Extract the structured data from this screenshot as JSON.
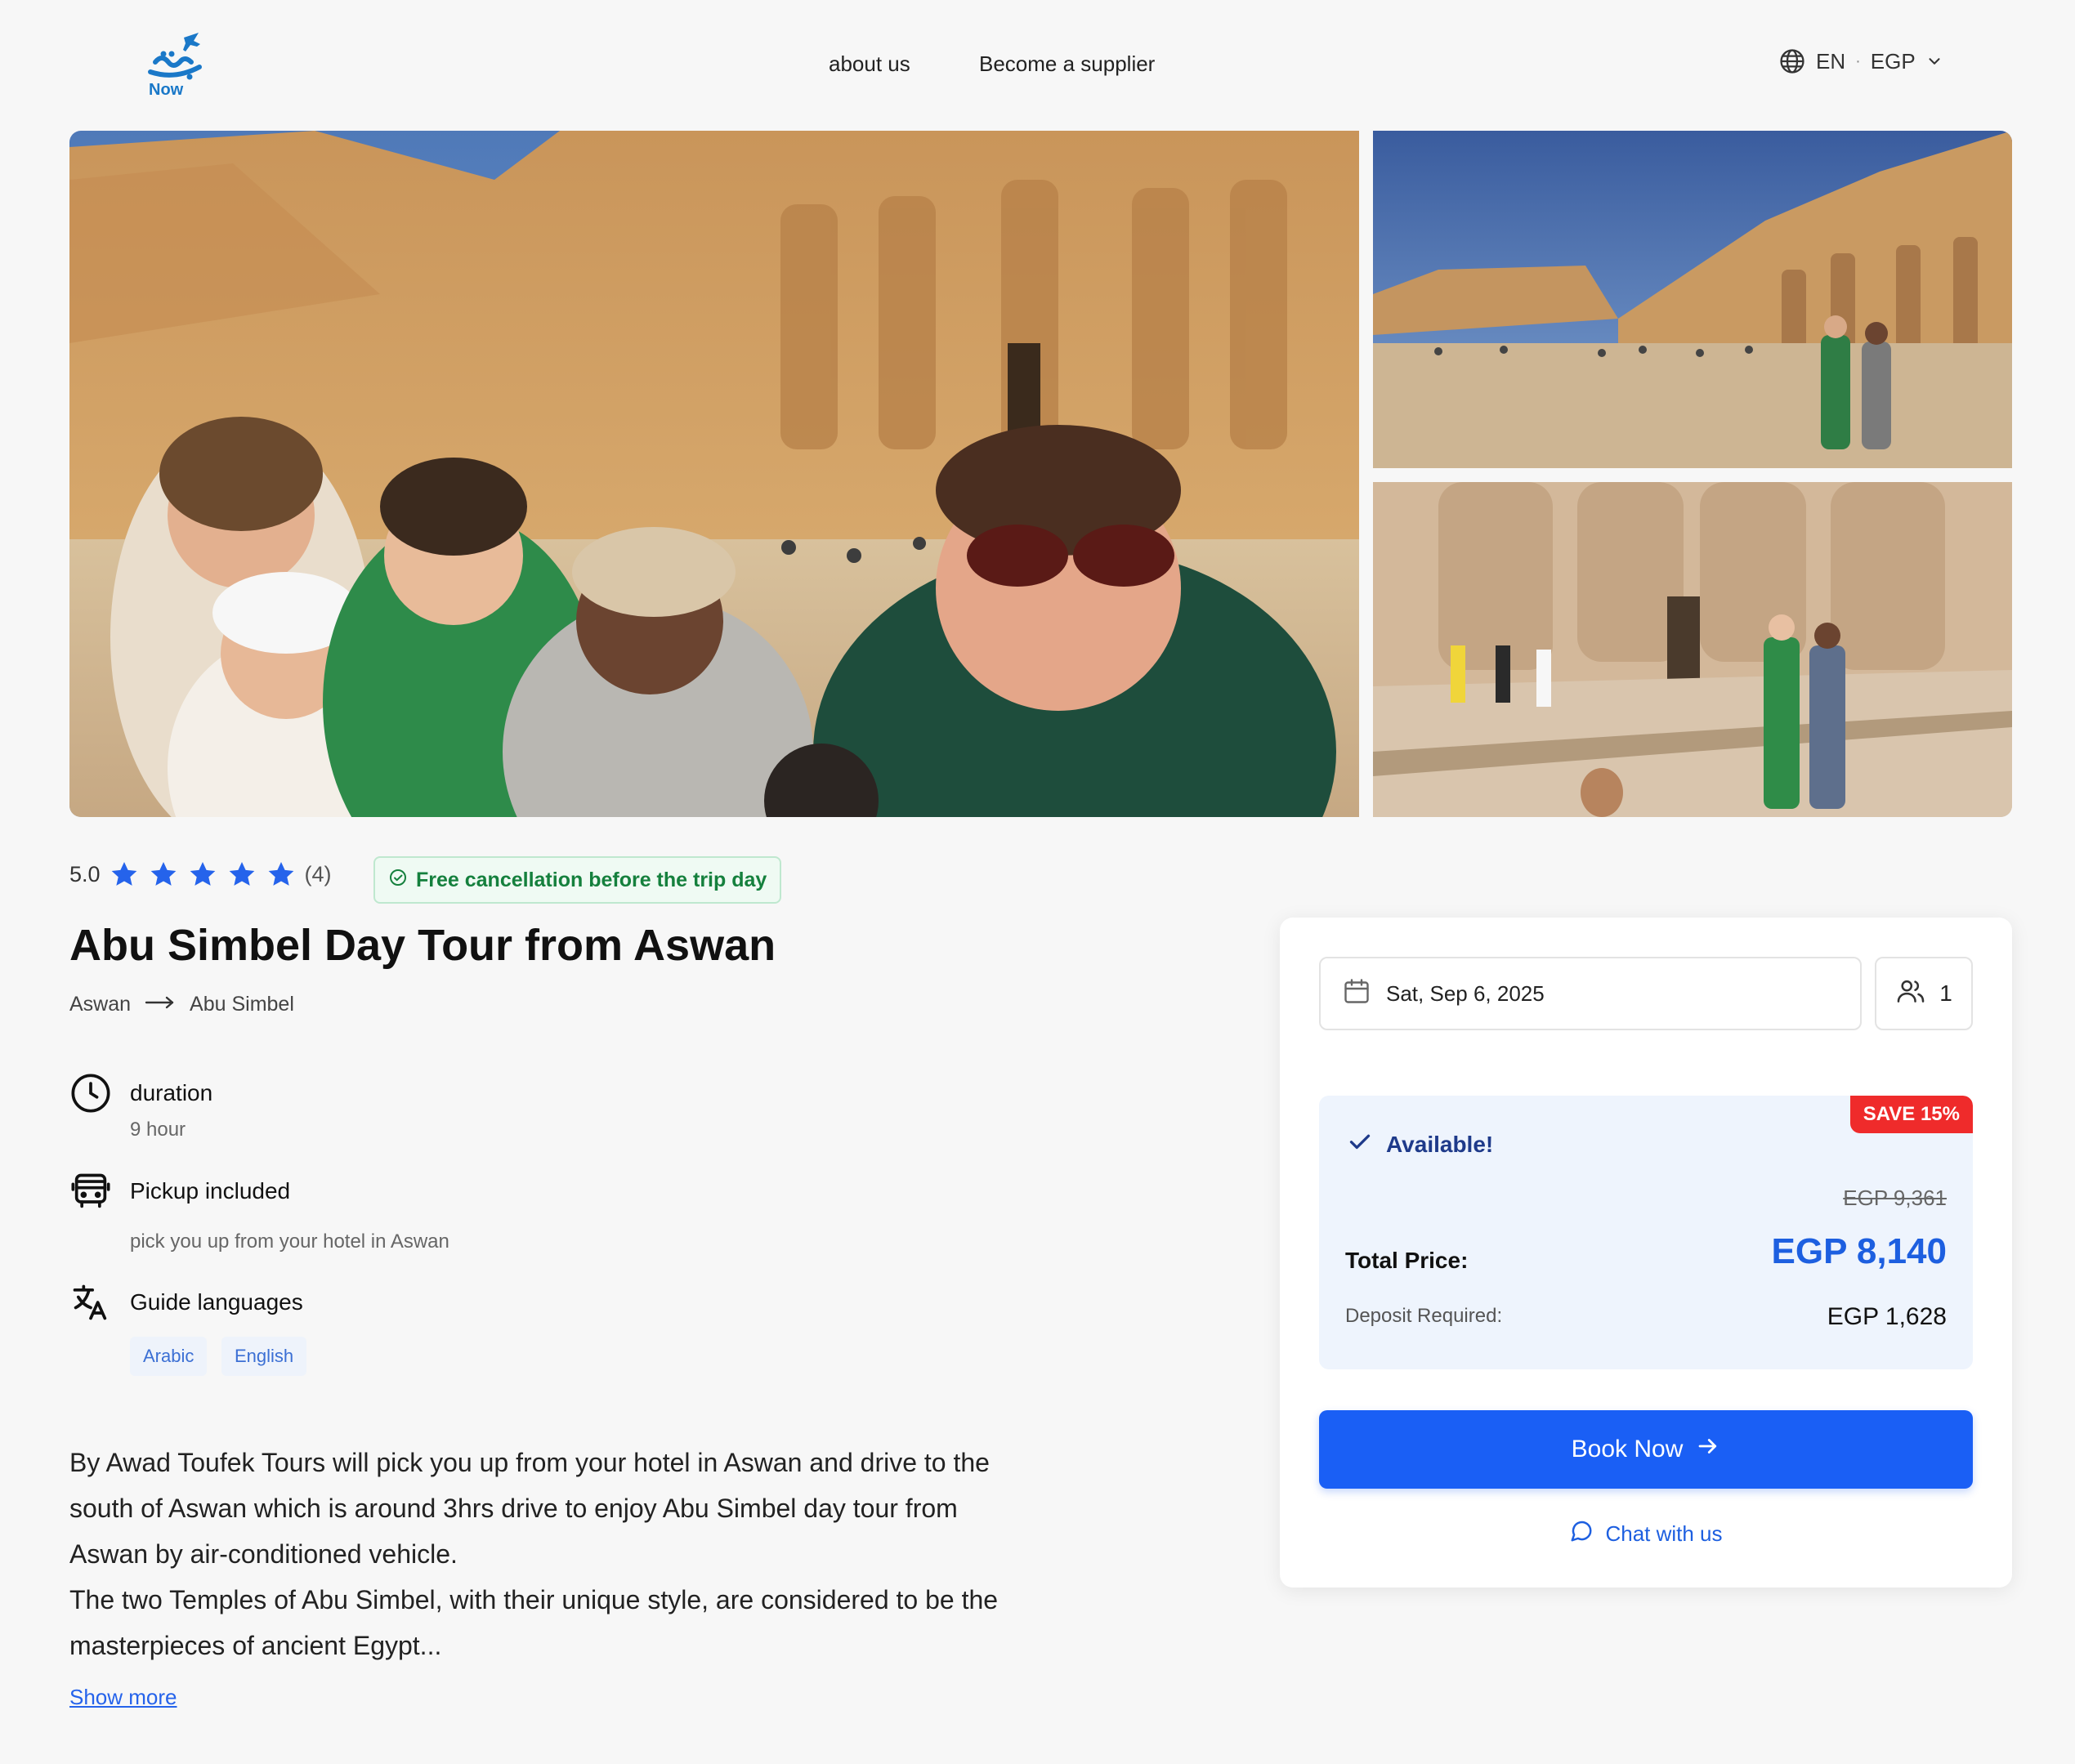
{
  "header": {
    "logo_text": "Now",
    "nav": [
      {
        "label": "about us"
      },
      {
        "label": "Become a supplier"
      }
    ],
    "locale": {
      "language": "EN",
      "separator": "·",
      "currency": "EGP"
    }
  },
  "gallery": {
    "images": [
      {
        "name": "family-selfie-abu-simbel"
      },
      {
        "name": "abu-simbel-temples-wide"
      },
      {
        "name": "ramses-statues-visitors"
      }
    ]
  },
  "rating": {
    "value": "5.0",
    "stars": 5,
    "count": "(4)"
  },
  "cancellation_badge": "Free cancellation before the trip day",
  "tour": {
    "title": "Abu Simbel Day Tour from Aswan",
    "route_from": "Aswan",
    "route_to": "Abu Simbel"
  },
  "features": {
    "duration_title": "duration",
    "duration_value": "9 hour",
    "pickup_title": "Pickup included",
    "pickup_value": "pick you up from your hotel in Aswan",
    "languages_title": "Guide languages",
    "languages": [
      "Arabic",
      "English"
    ]
  },
  "description": {
    "paragraph_1": "By Awad Toufek Tours will pick you up from your hotel in Aswan and drive to the south of Aswan which is around 3hrs drive to enjoy Abu Simbel day tour from Aswan by air-conditioned vehicle.",
    "paragraph_2": "The two Temples of Abu Simbel, with their unique style, are considered to be the masterpieces of ancient Egypt...",
    "show_more": "Show more"
  },
  "booking": {
    "date": "Sat, Sep 6, 2025",
    "guests": "1",
    "save_badge": "SAVE 15%",
    "available_label": "Available!",
    "old_price": "EGP 9,361",
    "total_label": "Total Price:",
    "total_price": "EGP 8,140",
    "deposit_label": "Deposit Required:",
    "deposit_value": "EGP 1,628",
    "book_button": "Book Now",
    "chat_link": "Chat with us"
  },
  "colors": {
    "primary": "#1a5ff5",
    "star": "#2563eb",
    "save_badge": "#ef2b2b",
    "success": "#15803d"
  }
}
